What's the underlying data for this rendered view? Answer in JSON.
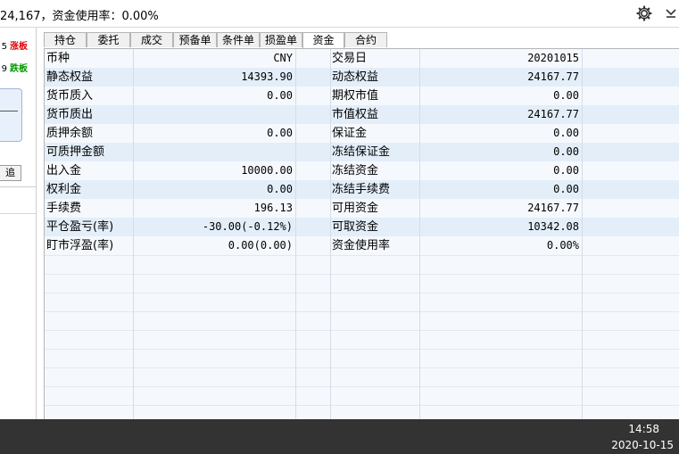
{
  "header": {
    "status_text": "24,167，资金使用率：0.00%",
    "settings_icon": "gear-icon",
    "menu_icon": "chevron-down-icon"
  },
  "left_panel": {
    "rows": [
      {
        "num": "5",
        "limit": "涨板",
        "color": "#e00000"
      },
      {
        "num": "9",
        "limit": "跌板",
        "color": "#009900"
      }
    ],
    "box_text": "-",
    "button_label": "追"
  },
  "tabs": [
    "持仓",
    "委托",
    "成交",
    "预备单",
    "条件单",
    "损盈单",
    "资金",
    "合约"
  ],
  "active_tab": "资金",
  "fund_table": {
    "rows": [
      {
        "label_left": "币种",
        "value_left": "CNY",
        "label_right": "交易日",
        "value_right": "20201015"
      },
      {
        "label_left": "静态权益",
        "value_left": "14393.90",
        "label_right": "动态权益",
        "value_right": "24167.77"
      },
      {
        "label_left": "货币质入",
        "value_left": "0.00",
        "label_right": "期权市值",
        "value_right": "0.00"
      },
      {
        "label_left": "货币质出",
        "value_left": "",
        "label_right": "市值权益",
        "value_right": "24167.77"
      },
      {
        "label_left": "质押余额",
        "value_left": "0.00",
        "label_right": "保证金",
        "value_right": "0.00"
      },
      {
        "label_left": "可质押金额",
        "value_left": "",
        "label_right": "冻结保证金",
        "value_right": "0.00"
      },
      {
        "label_left": "出入金",
        "value_left": "10000.00",
        "label_right": "冻结资金",
        "value_right": "0.00"
      },
      {
        "label_left": "权利金",
        "value_left": "0.00",
        "label_right": "冻结手续费",
        "value_right": "0.00"
      },
      {
        "label_left": "手续费",
        "value_left": "196.13",
        "label_right": "可用资金",
        "value_right": "24167.77"
      },
      {
        "label_left": "平仓盈亏(率)",
        "value_left": "-30.00(-0.12%)",
        "label_right": "可取资金",
        "value_right": "10342.08"
      },
      {
        "label_left": "盯市浮盈(率)",
        "value_left": "0.00(0.00)",
        "label_right": "资金使用率",
        "value_right": "0.00%"
      }
    ]
  },
  "taskbar": {
    "time": "14:58",
    "date": "2020-10-15"
  }
}
